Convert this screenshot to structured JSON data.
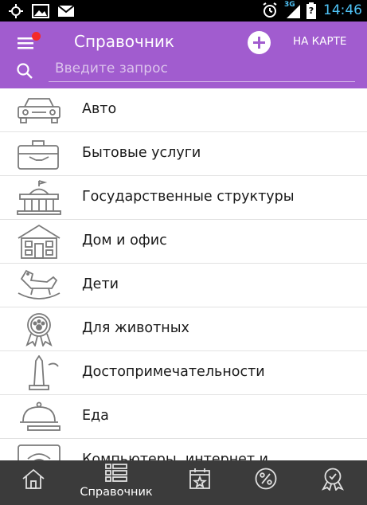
{
  "status_bar": {
    "network": "3G",
    "battery_text": "?",
    "time": "14:46"
  },
  "app_bar": {
    "title": "Справочник",
    "map_button": "НА КАРТЕ",
    "accent_color": "#a15ccf",
    "notification_dot_color": "#f42a2a"
  },
  "search": {
    "value": "",
    "placeholder": "Введите запрос"
  },
  "categories": [
    {
      "label": "Авто",
      "icon": "car-icon"
    },
    {
      "label": "Бытовые услуги",
      "icon": "toolbox-icon"
    },
    {
      "label": "Государственные структуры",
      "icon": "government-building-icon"
    },
    {
      "label": "Дом и офис",
      "icon": "house-icon"
    },
    {
      "label": "Дети",
      "icon": "rocking-horse-icon"
    },
    {
      "label": "Для животных",
      "icon": "paw-badge-icon"
    },
    {
      "label": "Достопримечательности",
      "icon": "monument-icon"
    },
    {
      "label": "Еда",
      "icon": "food-cloche-icon"
    },
    {
      "label": "Компьютеры, интернет и",
      "icon": "wifi-icon"
    }
  ],
  "bottom_nav": {
    "items": [
      {
        "icon": "home-icon",
        "label": ""
      },
      {
        "icon": "catalog-list-icon",
        "label": "Справочник",
        "active": true
      },
      {
        "icon": "calendar-star-icon",
        "label": ""
      },
      {
        "icon": "percent-icon",
        "label": ""
      },
      {
        "icon": "award-icon",
        "label": ""
      }
    ],
    "background": "#3b3b3b"
  }
}
